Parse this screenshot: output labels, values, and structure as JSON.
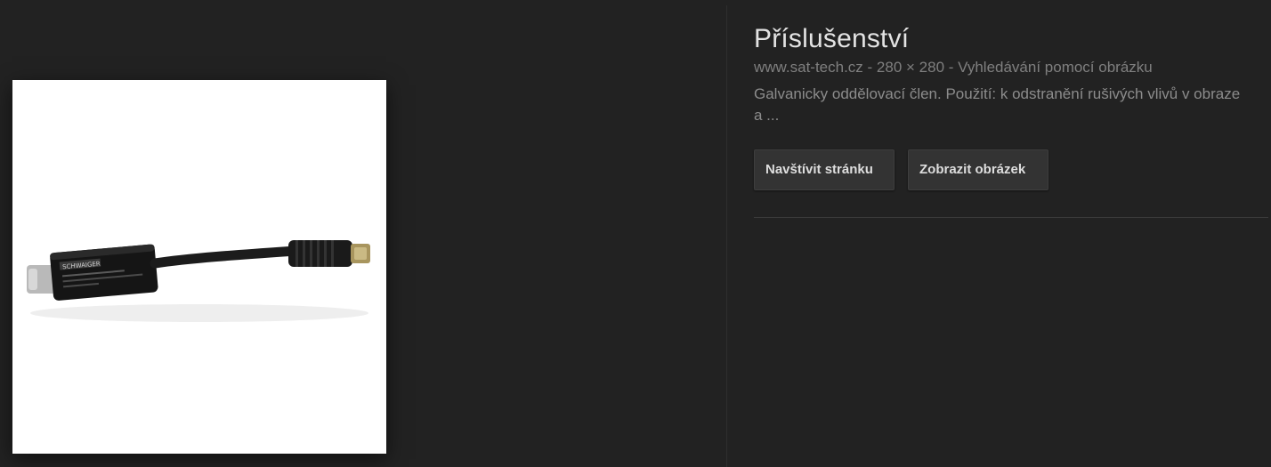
{
  "result": {
    "title": "Příslušenství",
    "source_line": "www.sat-tech.cz - 280 × 280 - Vyhledávání pomocí obrázku",
    "description": "Galvanicky oddělovací člen. Použití: k odstranění rušivých vlivů v obraze a ...",
    "buttons": {
      "visit_label": "Navštívit stránku",
      "view_label": "Zobrazit obrázek"
    }
  },
  "preview": {
    "subject": "antenna-cable-isolator-image",
    "device_label": "SCHWAIGER"
  },
  "colors": {
    "background": "#222222",
    "title": "#e3e3e3",
    "meta_text": "#7f7f7f",
    "button_bg": "#333333",
    "button_text": "#dedede"
  }
}
